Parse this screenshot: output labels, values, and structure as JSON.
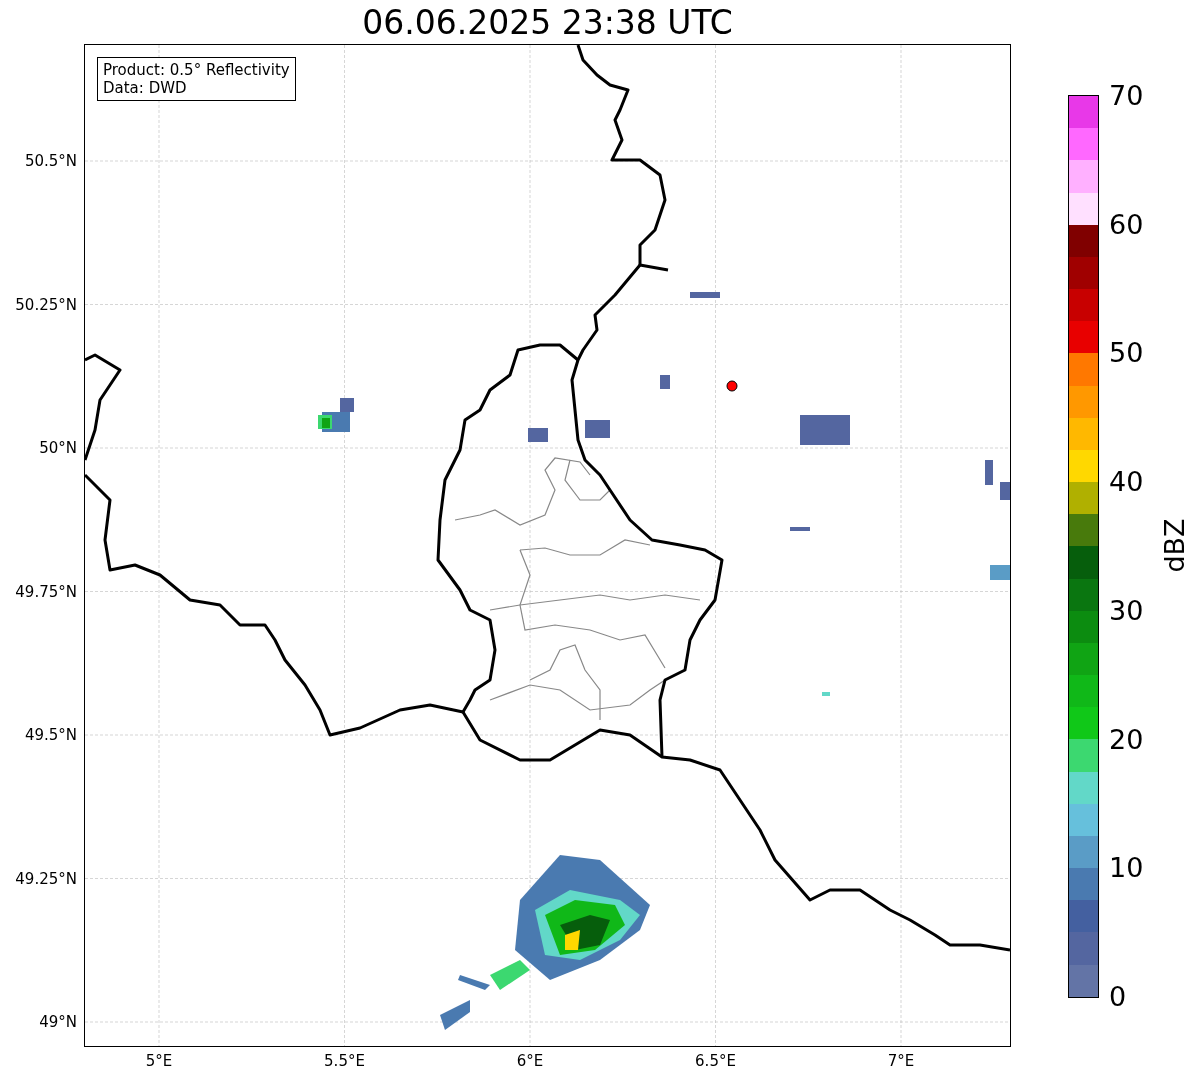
{
  "title": "06.06.2025 23:38 UTC",
  "legend": {
    "lines": [
      "Product: 0.5° Reflectivity",
      "Data: DWD"
    ]
  },
  "map": {
    "yticks": [
      "50.5°N",
      "50.25°N",
      "50°N",
      "49.75°N",
      "49.5°N",
      "49.25°N",
      "49°N"
    ],
    "xticks": [
      "5°E",
      "5.5°E",
      "6°E",
      "6.5°E",
      "7°E"
    ]
  },
  "colorbar": {
    "label": "dBZ",
    "ticks": [
      "70",
      "60",
      "50",
      "40",
      "30",
      "20",
      "10",
      "0"
    ],
    "bins": [
      {
        "color": "#e838e8"
      },
      {
        "color": "#ff68ff"
      },
      {
        "color": "#ffb0ff"
      },
      {
        "color": "#ffe0ff"
      },
      {
        "color": "#800000"
      },
      {
        "color": "#a00000"
      },
      {
        "color": "#c80000"
      },
      {
        "color": "#e80000"
      },
      {
        "color": "#ff7800"
      },
      {
        "color": "#ff9800"
      },
      {
        "color": "#ffb800"
      },
      {
        "color": "#ffd800"
      },
      {
        "color": "#b0b000"
      },
      {
        "color": "#487a0c"
      },
      {
        "color": "#065e0c"
      },
      {
        "color": "#0a7610"
      },
      {
        "color": "#0c8c10"
      },
      {
        "color": "#10a414"
      },
      {
        "color": "#10b818"
      },
      {
        "color": "#10c818"
      },
      {
        "color": "#3cd870"
      },
      {
        "color": "#62d8c8"
      },
      {
        "color": "#66c0dc"
      },
      {
        "color": "#5a9cc6"
      },
      {
        "color": "#4a7ab0"
      },
      {
        "color": "#4460a0"
      },
      {
        "color": "#5466a0"
      },
      {
        "color": "#6374a6"
      }
    ]
  }
}
